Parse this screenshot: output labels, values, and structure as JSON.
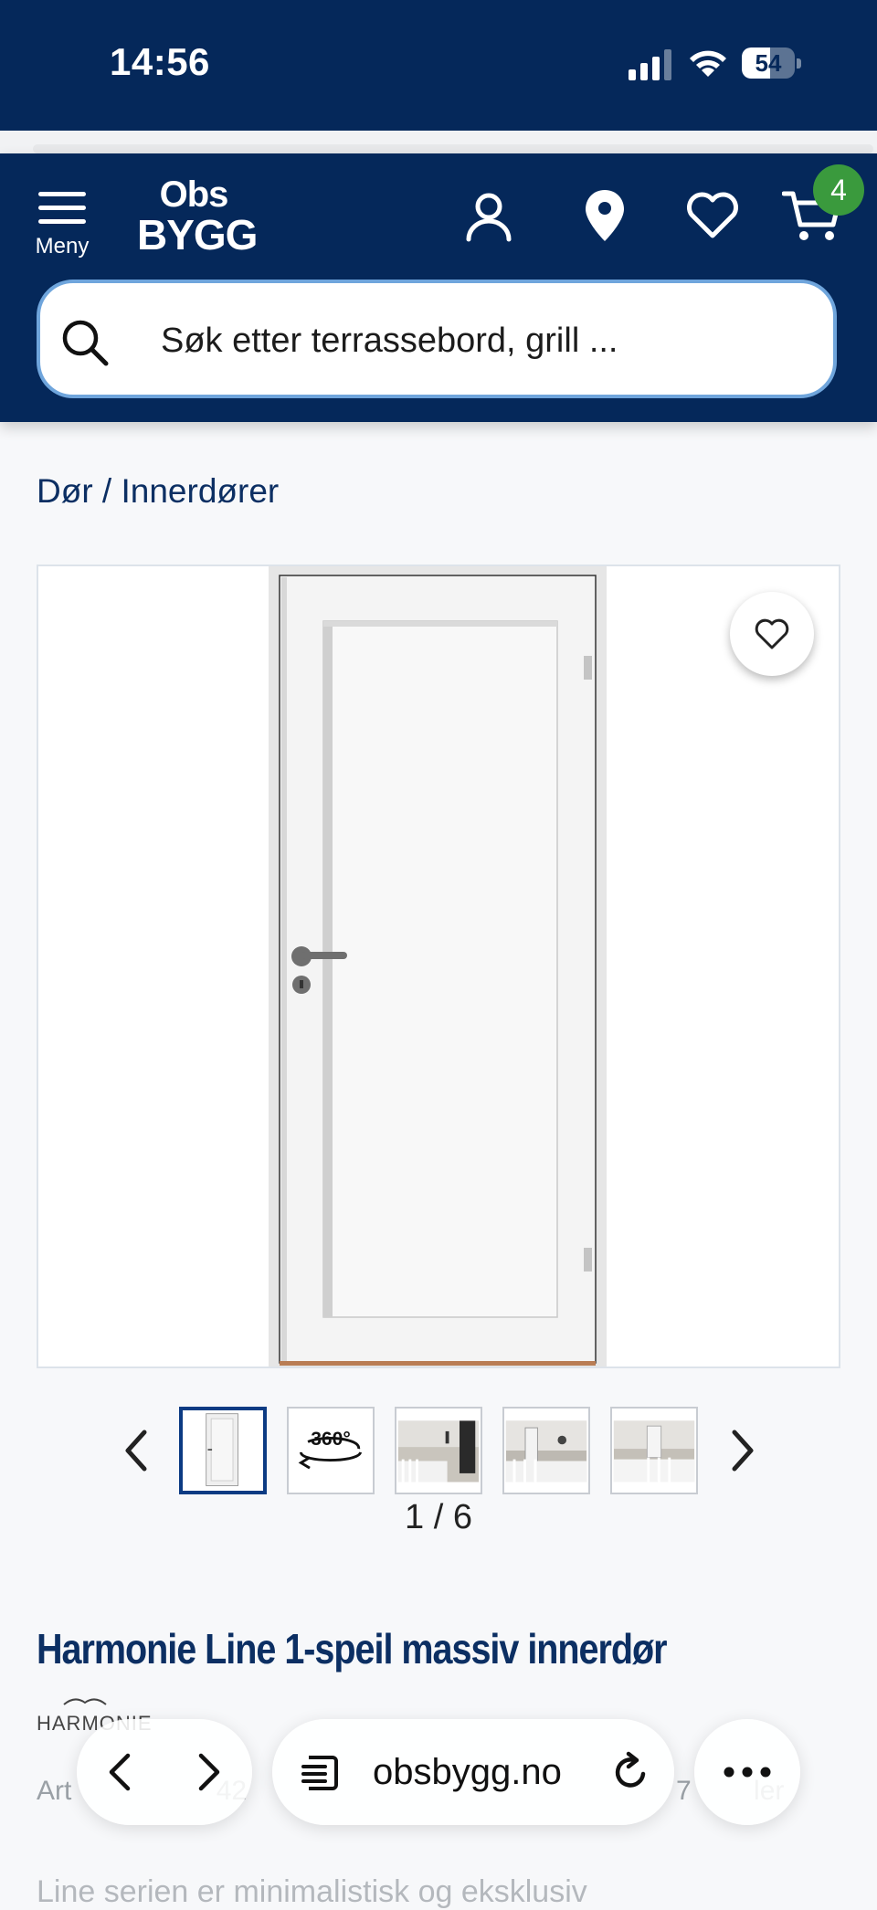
{
  "status_bar": {
    "time": "14:56",
    "battery_level": 54,
    "battery": "54"
  },
  "header": {
    "menu_label": "Meny",
    "logo_top": "Obs",
    "logo_bottom": "BYGG",
    "cart_count": "4",
    "icons": [
      "account-icon",
      "location-pin-icon",
      "heart-icon",
      "cart-icon"
    ]
  },
  "search": {
    "placeholder": "Søk etter terrassebord, grill ..."
  },
  "breadcrumb": {
    "category": "Dør",
    "separator": " / ",
    "subcategory": "Innerdører"
  },
  "gallery": {
    "counter": "1 / 6",
    "thumbnails": [
      "door-front",
      "360-view",
      "room-photo-1",
      "room-photo-2",
      "room-photo-3"
    ],
    "view_360_label": "360°"
  },
  "product": {
    "title": "Harmonie Line 1-speil massiv innerdør",
    "brand": "HARMONIE",
    "artnr_visible": "Art",
    "artnr_partial": "42",
    "rating_count_text": "7",
    "rating_suffix": "ler",
    "description_partial": "Line serien er minimalistisk og eksklusiv"
  },
  "browser": {
    "url": "obsbygg.no"
  },
  "colors": {
    "brand_navy": "#05285a",
    "badge_green": "#3a9a3d",
    "search_border": "#6fa5dc",
    "title_blue": "#0c2f63"
  }
}
